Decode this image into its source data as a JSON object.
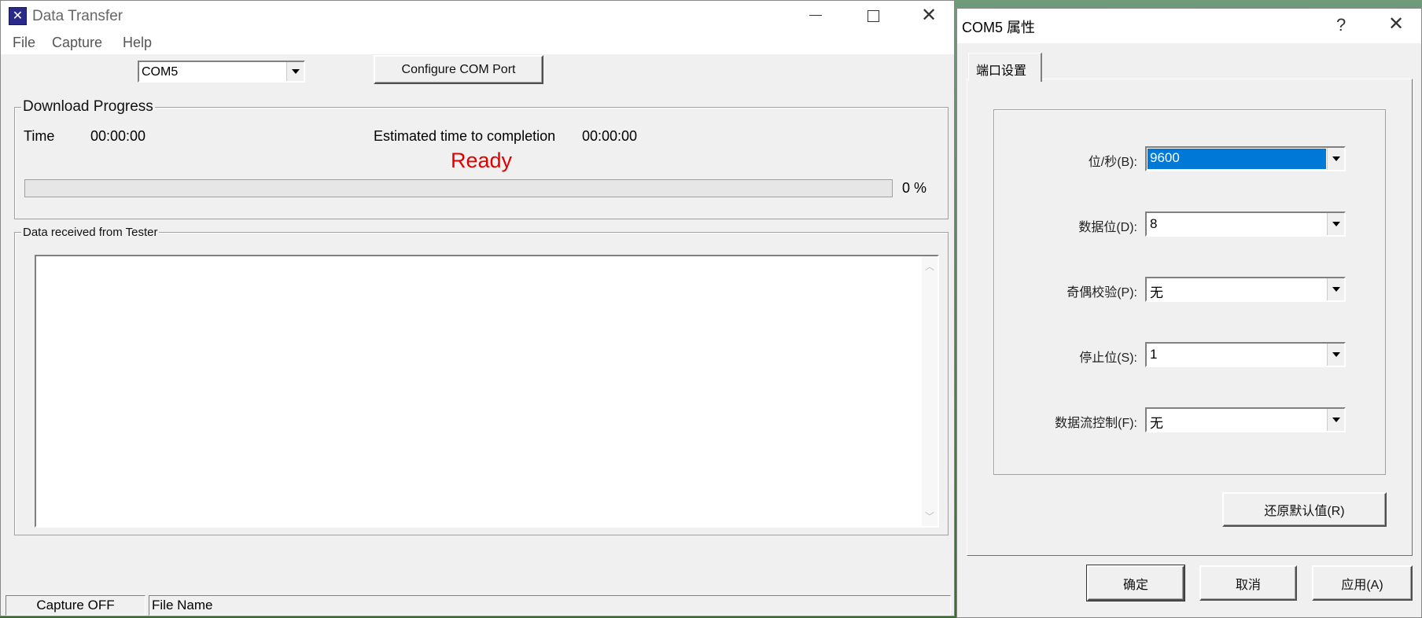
{
  "main_window": {
    "title": "Data Transfer",
    "menu": [
      "File",
      "Capture",
      "Help"
    ],
    "port_select": {
      "value": "COM5"
    },
    "configure_button": "Configure COM Port",
    "download_progress": {
      "label": "Download Progress",
      "time_label": "Time",
      "time_value": "00:00:00",
      "eta_label": "Estimated time to completion",
      "eta_value": "00:00:00",
      "status": "Ready",
      "status_color": "#e00000",
      "progress_percent": 0,
      "progress_text": "0 %"
    },
    "data_received": {
      "label": "Data received from Tester",
      "content": ""
    },
    "statusbar": {
      "capture": "Capture OFF",
      "file": "File Name"
    }
  },
  "dialog": {
    "title": "COM5 属性",
    "help": "?",
    "tab": "端口设置",
    "fields": [
      {
        "label": "位/秒(B):",
        "value": "9600",
        "selected": true
      },
      {
        "label": "数据位(D):",
        "value": "8"
      },
      {
        "label": "奇偶校验(P):",
        "value": "无"
      },
      {
        "label": "停止位(S):",
        "value": "1"
      },
      {
        "label": "数据流控制(F):",
        "value": "无"
      }
    ],
    "restore_button": "还原默认值(R)",
    "ok_button": "确定",
    "cancel_button": "取消",
    "apply_button": "应用(A)",
    "selection_color": "#0078d7"
  }
}
